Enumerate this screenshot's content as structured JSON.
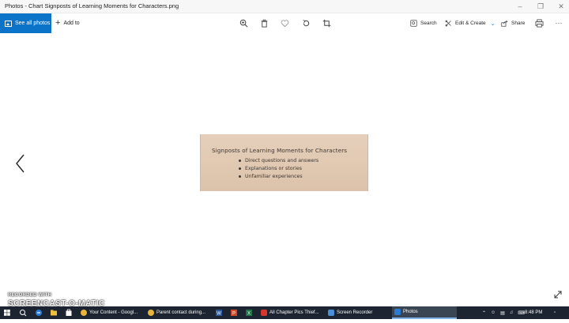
{
  "window": {
    "title": "Photos - Chart Signposts of Learning Moments for Characters.png"
  },
  "toolbar": {
    "see_all_label": "See all photos",
    "add_to_label": "Add to",
    "search_label": "Search",
    "edit_create_label": "Edit & Create",
    "share_label": "Share"
  },
  "photo": {
    "title": "Signposts of Learning Moments for Characters",
    "bullets": [
      "Direct questions and answers",
      "Explanations or stories",
      "Unfamiliar experiences"
    ]
  },
  "watermark": {
    "line1": "RECORDED WITH",
    "line2": "SCREENCAST-O-MATIC"
  },
  "taskbar": {
    "tasks": [
      {
        "label": "Your Content - Googl...",
        "icon": "chrome-icon",
        "color": "#e8b43a"
      },
      {
        "label": "Parent contact during...",
        "icon": "chrome-icon",
        "color": "#e8b43a"
      },
      {
        "label": "All Chapter Pics Thief...",
        "icon": "pdf-icon",
        "color": "#d6362b"
      },
      {
        "label": "Screen Recorder",
        "icon": "recorder-icon",
        "color": "#4a90d9"
      },
      {
        "label": "Photos",
        "icon": "photos-icon",
        "color": "#2b7cd3"
      }
    ],
    "clock": "8:48 PM"
  },
  "colors": {
    "accent": "#0b74c9",
    "taskbar": "#1b2430",
    "photo_background": "#e2c9b3"
  }
}
